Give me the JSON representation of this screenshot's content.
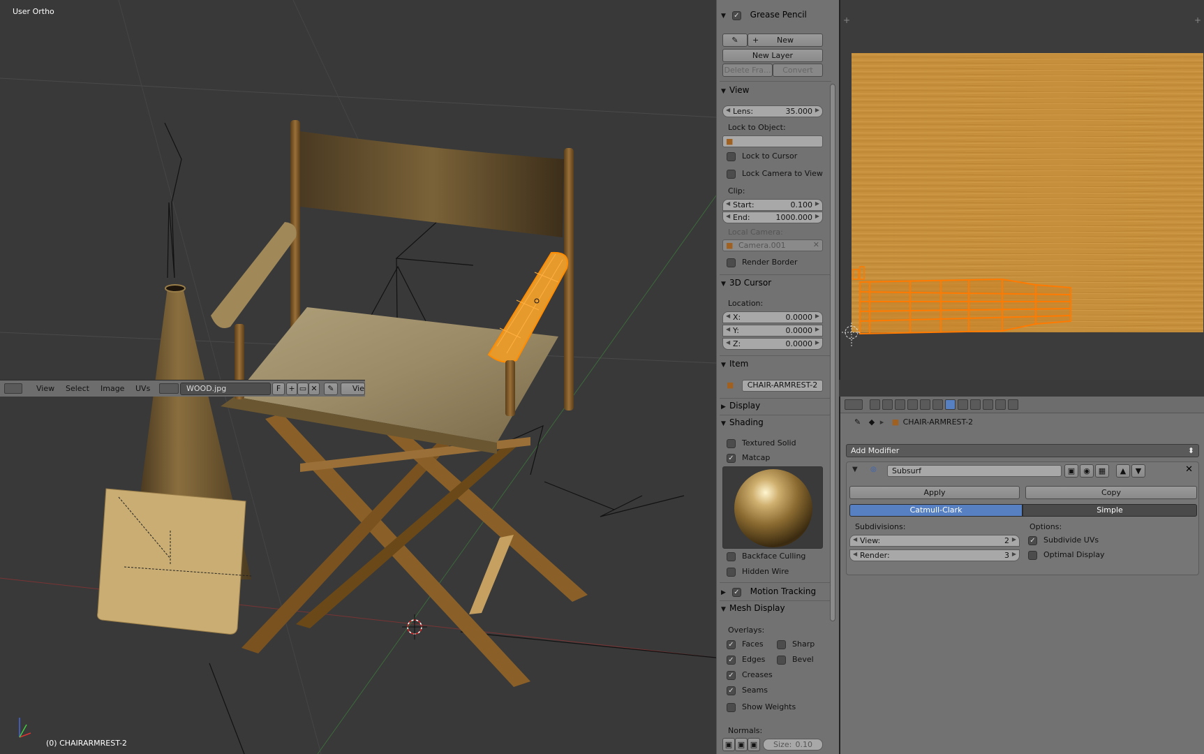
{
  "viewport": {
    "title": "User Ortho",
    "status": "(0) CHAIRARMREST-2"
  },
  "npanel": {
    "grease_pencil": {
      "label": "Grease Pencil",
      "new": "New",
      "new_layer": "New Layer",
      "delete_frame": "Delete Fra...",
      "convert": "Convert"
    },
    "view": {
      "label": "View",
      "lens_label": "Lens:",
      "lens_value": "35.000",
      "lock_to_object": "Lock to Object:",
      "lock_to_cursor": "Lock to Cursor",
      "lock_camera_to_view": "Lock Camera to View",
      "clip": "Clip:",
      "start_label": "Start:",
      "start_value": "0.100",
      "end_label": "End:",
      "end_value": "1000.000",
      "local_camera": "Local Camera:",
      "camera_value": "Camera.001",
      "render_border": "Render Border"
    },
    "cursor": {
      "label": "3D Cursor",
      "location": "Location:",
      "x_label": "X:",
      "x_value": "0.0000",
      "y_label": "Y:",
      "y_value": "0.0000",
      "z_label": "Z:",
      "z_value": "0.0000"
    },
    "item": {
      "label": "Item",
      "name": "CHAIR-ARMREST-2"
    },
    "display": {
      "label": "Display"
    },
    "shading": {
      "label": "Shading",
      "textured_solid": "Textured Solid",
      "matcap": "Matcap",
      "backface_culling": "Backface Culling",
      "hidden_wire": "Hidden Wire"
    },
    "motion_tracking": {
      "label": "Motion Tracking"
    },
    "mesh_display": {
      "label": "Mesh Display",
      "overlays": "Overlays:",
      "faces": "Faces",
      "sharp": "Sharp",
      "edges": "Edges",
      "bevel": "Bevel",
      "creases": "Creases",
      "seams": "Seams",
      "show_weights": "Show Weights",
      "normals": "Normals:",
      "size_label": "Size:",
      "size_value": "0.10"
    }
  },
  "image_editor": {
    "menus": [
      "View",
      "Select",
      "Image",
      "UVs"
    ],
    "image_name": "WOOD.jpg",
    "fake_user": "F",
    "view_trunc": "Vie"
  },
  "properties": {
    "breadcrumb": "CHAIR-ARMREST-2",
    "add_modifier": "Add Modifier",
    "modifier": {
      "name": "Subsurf",
      "apply": "Apply",
      "copy": "Copy",
      "catmull_clark": "Catmull-Clark",
      "simple": "Simple",
      "subdivisions": "Subdivisions:",
      "options": "Options:",
      "view_label": "View:",
      "view_value": "2",
      "render_label": "Render:",
      "render_value": "3",
      "subdivide_uvs": "Subdivide UVs",
      "optimal_display": "Optimal Display"
    }
  },
  "colors": {
    "accent": "#5680c2",
    "selection": "#ff8c00",
    "wood": "#c9953f"
  }
}
